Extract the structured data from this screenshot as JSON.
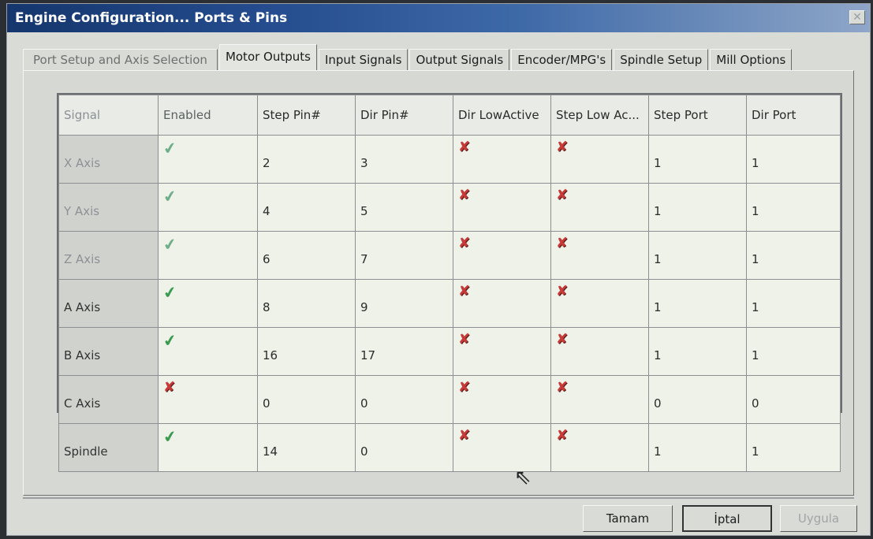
{
  "window": {
    "title": "Engine Configuration... Ports & Pins",
    "close_symbol": "✕"
  },
  "tabs": [
    {
      "label": "Port Setup and Axis Selection",
      "active": false
    },
    {
      "label": "Motor Outputs",
      "active": true
    },
    {
      "label": "Input Signals",
      "active": false
    },
    {
      "label": "Output Signals",
      "active": false
    },
    {
      "label": "Encoder/MPG's",
      "active": false
    },
    {
      "label": "Spindle Setup",
      "active": false
    },
    {
      "label": "Mill Options",
      "active": false
    }
  ],
  "grid": {
    "headers": [
      "Signal",
      "Enabled",
      "Step Pin#",
      "Dir Pin#",
      "Dir LowActive",
      "Step Low Ac...",
      "Step Port",
      "Dir Port"
    ],
    "rows": [
      {
        "signal": "X Axis",
        "enabled": true,
        "step_pin": "2",
        "dir_pin": "3",
        "dir_low_active": false,
        "step_low_active": false,
        "step_port": "1",
        "dir_port": "1"
      },
      {
        "signal": "Y Axis",
        "enabled": true,
        "step_pin": "4",
        "dir_pin": "5",
        "dir_low_active": false,
        "step_low_active": false,
        "step_port": "1",
        "dir_port": "1"
      },
      {
        "signal": "Z Axis",
        "enabled": true,
        "step_pin": "6",
        "dir_pin": "7",
        "dir_low_active": false,
        "step_low_active": false,
        "step_port": "1",
        "dir_port": "1"
      },
      {
        "signal": "A Axis",
        "enabled": true,
        "step_pin": "8",
        "dir_pin": "9",
        "dir_low_active": false,
        "step_low_active": false,
        "step_port": "1",
        "dir_port": "1"
      },
      {
        "signal": "B Axis",
        "enabled": true,
        "step_pin": "16",
        "dir_pin": "17",
        "dir_low_active": false,
        "step_low_active": false,
        "step_port": "1",
        "dir_port": "1"
      },
      {
        "signal": "C Axis",
        "enabled": false,
        "step_pin": "0",
        "dir_pin": "0",
        "dir_low_active": false,
        "step_low_active": false,
        "step_port": "0",
        "dir_port": "0"
      },
      {
        "signal": "Spindle",
        "enabled": true,
        "step_pin": "14",
        "dir_pin": "0",
        "dir_low_active": false,
        "step_low_active": false,
        "step_port": "1",
        "dir_port": "1"
      }
    ]
  },
  "buttons": {
    "ok": "Tamam",
    "cancel": "İptal",
    "apply": "Uygula"
  },
  "icons": {
    "check": "check-icon",
    "cross": "cross-icon"
  }
}
